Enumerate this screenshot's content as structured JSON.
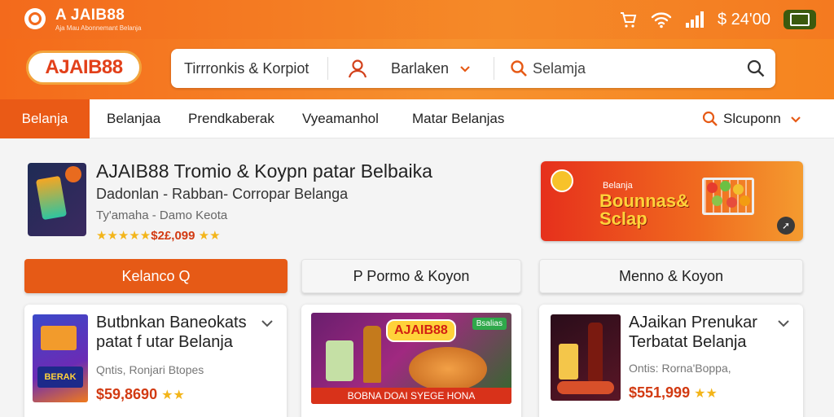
{
  "status_bar": {
    "app_name": "A JAIB88",
    "tagline": "Aja Mau Abonnemant Belanja",
    "balance": "$ 24'00"
  },
  "header": {
    "logo_text": "AJAIB88",
    "search_segment_1": "Tirrronkis & Korpiot",
    "search_segment_2": "Barlaken",
    "search_placeholder": "Selamja"
  },
  "nav": {
    "items": [
      "Belanja",
      "Belanjaa",
      "Prendkaberak",
      "Vyeamanhol",
      "Matar Belanjas"
    ],
    "coupon_label": "Slcuponn"
  },
  "promo": {
    "title": "AJAIB88 Tromio & Koypn patar Belbaika",
    "subtitle": "Dadonlan - Rabban- Corropar Belanga",
    "meta": "Ty'amaha  - Damo Keota",
    "price": "$2£,099",
    "stars_before": "★★★★★",
    "stars_after": "★★"
  },
  "banner": {
    "small_text": "Belanja",
    "big_text_line1": "Bounnas&",
    "big_text_line2": "Sclap"
  },
  "tabs": [
    "Kelanco Q",
    "P Pormo & Koyon",
    "Menno & Koyon"
  ],
  "cards": [
    {
      "title_line1": "Butbnkan Baneokats",
      "title_line2": "patat f utar Belanja",
      "subtitle": "Qntis, Ronjari Btopes",
      "price": "$59,8690",
      "stars": "★★",
      "image_text": "BERAK"
    },
    {
      "logo": "AJAIB88",
      "tag": "Bsalias",
      "footer": "BOBNA DOAI SYEGE HONA"
    },
    {
      "title_line1": "AJaikan Prenukar",
      "title_line2": "Terbatat Belanja",
      "subtitle": "Ontis: Rorna'Boppa,",
      "price": "$551,999",
      "stars": "★★"
    }
  ],
  "colors": {
    "brand_orange": "#f36a1c",
    "accent_red": "#d23a12",
    "star_yellow": "#f3b51a"
  }
}
